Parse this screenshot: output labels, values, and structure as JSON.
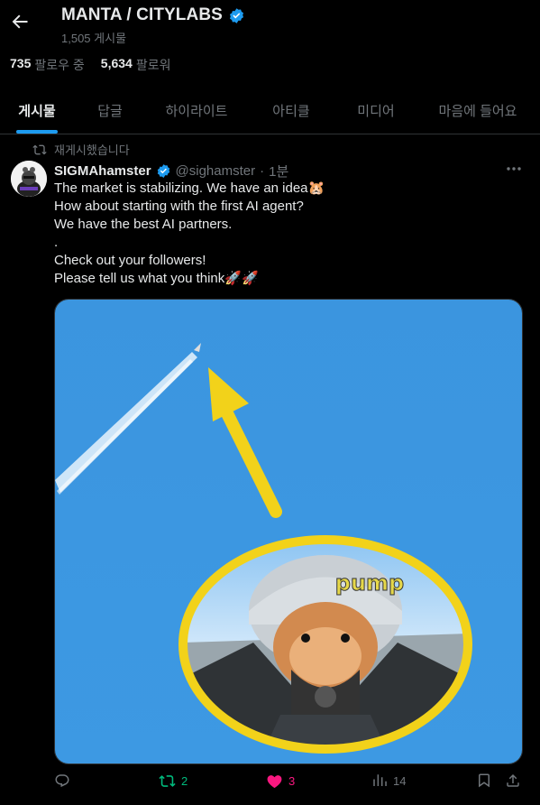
{
  "header": {
    "title": "MANTA / CITYLABS",
    "post_count": "1,505 게시물",
    "following_count": "735",
    "following_label": "팔로우 중",
    "followers_count": "5,634",
    "followers_label": "팔로워"
  },
  "tabs": [
    {
      "label": "게시물",
      "active": true
    },
    {
      "label": "답글"
    },
    {
      "label": "하이라이트"
    },
    {
      "label": "아티클"
    },
    {
      "label": "미디어"
    },
    {
      "label": "마음에 들어요"
    }
  ],
  "post": {
    "repost_label": "재게시했습니다",
    "author_name": "SIGMAhamster",
    "author_handle": "@sighamster",
    "dot": "·",
    "time": "1분",
    "lines": [
      "The market is stabilizing. We have an idea🐹",
      "How about starting with the first AI agent?",
      "We have the best AI partners.",
      ".",
      "Check out your followers!",
      "Please tell us what you think🚀🚀"
    ],
    "media_text": "pump",
    "actions": {
      "reply_count": "",
      "repost_count": "2",
      "like_count": "3",
      "views_count": "14"
    }
  },
  "colors": {
    "accent": "#1d9bf0",
    "repost_green": "#00ba7c",
    "like_pink": "#f91880",
    "sky_blue": "#3d97e0",
    "ring_yellow": "#f2d21a"
  }
}
